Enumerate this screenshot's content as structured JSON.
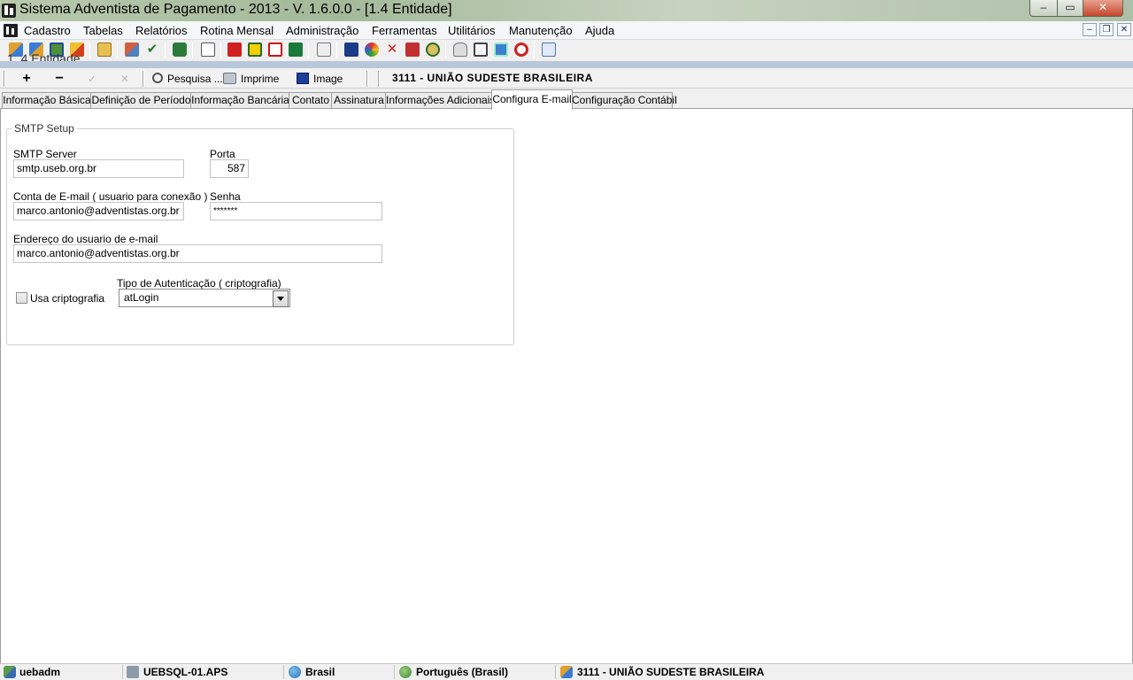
{
  "window": {
    "title": "Sistema Adventista de Pagamento - 2013 - V. 1.6.0.0 - [1.4 Entidade]",
    "controls": {
      "minimize": "‒",
      "maximize": "▭",
      "close": "✕"
    }
  },
  "menu": {
    "items": [
      "Cadastro",
      "Tabelas",
      "Relatórios",
      "Rotina Mensal",
      "Administração",
      "Ferramentas",
      "Utilitários",
      "Manutenção",
      "Ajuda"
    ],
    "mdi_controls": {
      "minimize": "‒",
      "restore": "❐",
      "close": "✕"
    }
  },
  "toolbar": {
    "icons": [
      "people-icon",
      "users-icon",
      "id-card-icon",
      "transfer-icon",
      "folder-user-icon",
      "copy-icon",
      "check-icon",
      "book-icon",
      "document-edit-icon",
      "bank-red-icon",
      "bank-yellow-icon",
      "bank-hsbc-icon",
      "bank-green-icon",
      "receipt-icon",
      "blue-diamond-icon",
      "colorful-icon",
      "x-icon",
      "pdf-icon",
      "seal-icon",
      "lock-icon",
      "clipboard-icon",
      "card-icon",
      "stop-icon",
      "copy-window-icon"
    ]
  },
  "child_window": {
    "title": "1. 4 Entidade"
  },
  "form_toolbar": {
    "add": "+",
    "remove": "−",
    "confirm": "✓",
    "cancel": "✕",
    "search": "Pesquisa ...",
    "print": "Imprime",
    "image": "Image",
    "entity": "3111 - UNIÃO SUDESTE BRASILEIRA"
  },
  "tabs": [
    {
      "label": "Informação Básica"
    },
    {
      "label": "Definição de Período"
    },
    {
      "label": "Informação Bancária"
    },
    {
      "label": "Contato"
    },
    {
      "label": "Assinatura"
    },
    {
      "label": "Informações Adicionais"
    },
    {
      "label": "Configura E-mail",
      "active": true
    },
    {
      "label": "Configuração Contábil"
    }
  ],
  "smtp": {
    "group_title": "SMTP Setup",
    "server_label": "SMTP Server",
    "server_value": "smtp.useb.org.br",
    "port_label": "Porta",
    "port_value": "587",
    "account_label": "Conta de E-mail ( usuario para conexão )",
    "account_value": "marco.antonio@adventistas.org.br",
    "password_label": "Senha",
    "password_value": "*******",
    "address_label": "Endereço do usuario de e-mail",
    "address_value": "marco.antonio@adventistas.org.br",
    "crypto_label": "Usa criptografia",
    "crypto_checked": false,
    "auth_label": "Tipo de Autenticação ( criptografia)",
    "auth_value": "atLogin"
  },
  "status": {
    "user": "uebadm",
    "server": "UEBSQL-01.APS",
    "country": "Brasil",
    "language": "Português (Brasil)",
    "entity": "3111 - UNIÃO SUDESTE BRASILEIRA"
  },
  "colors": {
    "child_strip": "#b9c7da",
    "content_bg": "#ffffff"
  }
}
